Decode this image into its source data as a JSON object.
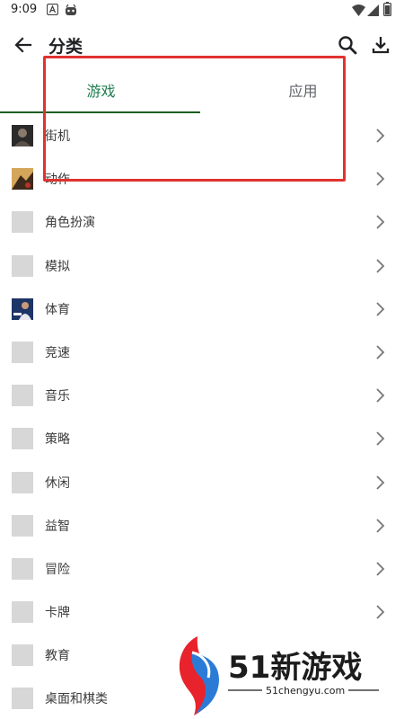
{
  "status_bar": {
    "time": "9:09",
    "icons": [
      "notification-a-icon",
      "robot-icon",
      "wifi-icon",
      "signal-icon",
      "battery-icon"
    ]
  },
  "toolbar": {
    "title": "分类",
    "back_icon": "arrow-back-icon",
    "actions": [
      "search-icon",
      "download-icon"
    ]
  },
  "tabs": {
    "items": [
      {
        "label": "游戏",
        "active": true
      },
      {
        "label": "应用",
        "active": false
      }
    ]
  },
  "categories": [
    {
      "label": "街机",
      "icon": "arcade-thumbnail"
    },
    {
      "label": "动作",
      "icon": "action-thumbnail"
    },
    {
      "label": "角色扮演",
      "icon": "placeholder"
    },
    {
      "label": "模拟",
      "icon": "placeholder"
    },
    {
      "label": "体育",
      "icon": "sports-thumbnail"
    },
    {
      "label": "竞速",
      "icon": "placeholder"
    },
    {
      "label": "音乐",
      "icon": "placeholder"
    },
    {
      "label": "策略",
      "icon": "placeholder"
    },
    {
      "label": "休闲",
      "icon": "placeholder"
    },
    {
      "label": "益智",
      "icon": "placeholder"
    },
    {
      "label": "冒险",
      "icon": "placeholder"
    },
    {
      "label": "卡牌",
      "icon": "placeholder"
    },
    {
      "label": "教育",
      "icon": "placeholder"
    },
    {
      "label": "桌面和棋类",
      "icon": "placeholder"
    }
  ],
  "watermark": {
    "brand": "51新游戏",
    "url": "51chengyu.com"
  },
  "colors": {
    "accent": "#1e7d4f",
    "indicator": "#1b5e20",
    "highlight": "#e0322f"
  }
}
